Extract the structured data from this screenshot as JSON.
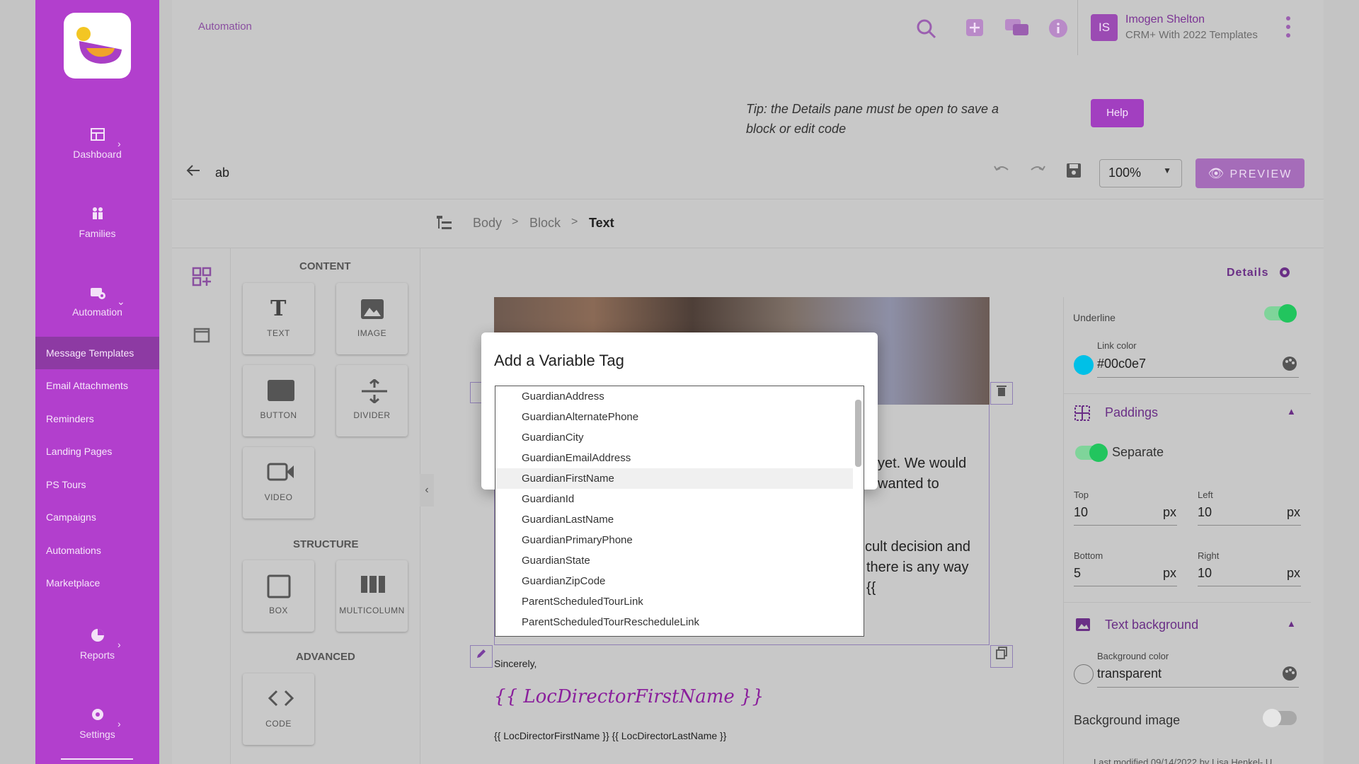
{
  "sidebar": {
    "top_items": [
      {
        "label": "Dashboard",
        "icon": "dashboard-icon",
        "chevron": "›"
      },
      {
        "label": "Families",
        "icon": "families-icon",
        "chevron": ""
      },
      {
        "label": "Automation",
        "icon": "automation-icon",
        "chevron": "⌄"
      }
    ],
    "sub_items": [
      "Message Templates",
      "Email Attachments",
      "Reminders",
      "Landing Pages",
      "PS Tours",
      "Campaigns",
      "Automations",
      "Marketplace"
    ],
    "active_sub": "Message Templates",
    "bottom_items": [
      {
        "label": "Reports",
        "icon": "reports-icon",
        "chevron": "›"
      },
      {
        "label": "Settings",
        "icon": "settings-icon",
        "chevron": "›"
      }
    ]
  },
  "topbar": {
    "crumb": "Automation",
    "icons": [
      "search-icon",
      "add-icon",
      "chat-icon",
      "info-icon",
      "more-icon"
    ],
    "user_initials": "IS",
    "user_name": "Imogen Shelton",
    "user_org": "CRM+ With 2022 Templates"
  },
  "tip": {
    "text": "Tip: the Details pane must be open to save a block or edit code",
    "help_label": "Help"
  },
  "editor": {
    "title": "ab",
    "zoom": "100%",
    "preview_label": "PREVIEW",
    "breadcrumb": [
      "Body",
      "Block",
      "Text"
    ],
    "details_label": "Details"
  },
  "blocks": {
    "content_title": "CONTENT",
    "content": [
      "TEXT",
      "IMAGE",
      "BUTTON",
      "DIVIDER",
      "VIDEO"
    ],
    "structure_title": "STRUCTURE",
    "structure": [
      "BOX",
      "MULTICOLUMN"
    ],
    "advanced_title": "ADVANCED",
    "advanced": [
      "CODE"
    ]
  },
  "canvas": {
    "line1": "yet. We would",
    "line2": "wanted to",
    "line3": "cult decision and",
    "line4": "there is any way",
    "line5": "{{",
    "sincerely": "Sincerely,",
    "signature": "{{ LocDirectorFirstName }}",
    "footer_vars": "{{ LocDirectorFirstName }} {{ LocDirectorLastName }}"
  },
  "details": {
    "underline_label": "Underline",
    "link_color_label": "Link color",
    "link_color": "#00c0e7",
    "paddings_label": "Paddings",
    "separate_label": "Separate",
    "top_label": "Top",
    "top_value": "10",
    "left_label": "Left",
    "left_value": "10",
    "bottom_label": "Bottom",
    "bottom_value": "5",
    "right_label": "Right",
    "right_value": "10",
    "unit": "px",
    "text_bg_label": "Text background",
    "bg_color_label": "Background color",
    "bg_color_value": "transparent",
    "bg_image_label": "Background image",
    "last_modified": "Last modified 09/14/2022 by Lisa Henkel- U"
  },
  "modal": {
    "title": "Add a Variable Tag",
    "items": [
      "GuardianAddress",
      "GuardianAlternatePhone",
      "GuardianCity",
      "GuardianEmailAddress",
      "GuardianFirstName",
      "GuardianId",
      "GuardianLastName",
      "GuardianPrimaryPhone",
      "GuardianState",
      "GuardianZipCode",
      "ParentScheduledTourLink",
      "ParentScheduledTourRescheduleLink"
    ],
    "highlighted": "GuardianFirstName"
  },
  "colors": {
    "sidebar": "#b23fcd",
    "accent": "#a23fc0",
    "toggle_on": "#22c55e"
  }
}
